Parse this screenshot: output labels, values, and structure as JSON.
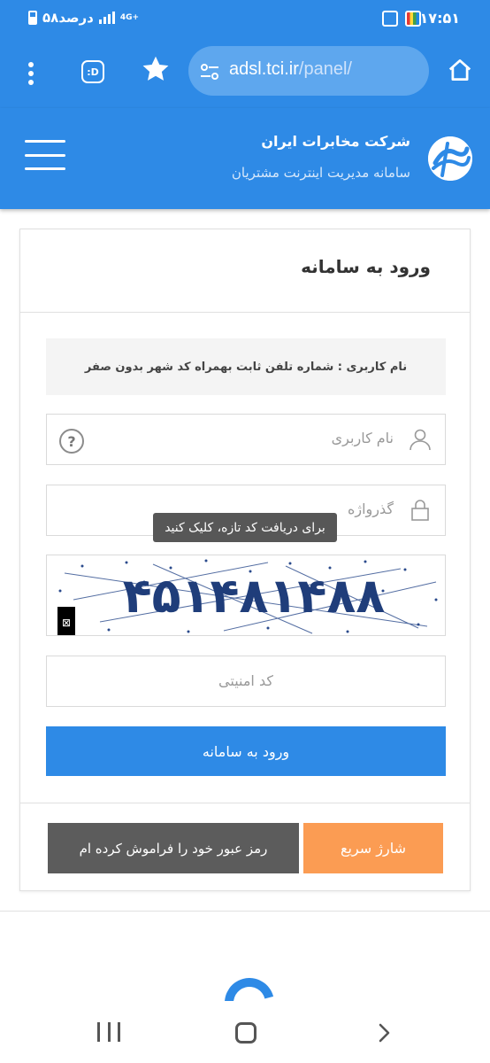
{
  "status_bar": {
    "time": "۱۷:۵۱",
    "battery": "۵۸درصد",
    "network": "4G+"
  },
  "browser": {
    "url_host": "adsl.tci.ir",
    "url_path": "/panel/",
    "ext_label": ":D",
    "icons": [
      "menu-dots-icon",
      "extension-icon",
      "star-icon",
      "site-settings-icon",
      "home-icon"
    ]
  },
  "header": {
    "title": "شرکت مخابرات ایران",
    "subtitle": "سامانه مدیریت اینترنت مشتریان"
  },
  "login": {
    "title": "ورود به سامانه",
    "notice": "نام کاربری : شماره تلفن ثابت بهمراه کد شهر بدون صفر",
    "username_placeholder": "نام کاربری",
    "help_label": "?",
    "password_placeholder": "گذرواژه",
    "tooltip": "برای دریافت کد تازه، کلیک کنید",
    "captcha_text": "۴۵۱۴۸۱۴۸۸",
    "refresh_glyph": "⊠",
    "security_code_placeholder": "کد امنیتی",
    "submit_label": "ورود به سامانه",
    "quick_charge_label": "شارژ سریع",
    "forgot_label": "رمز عبور خود را فراموش کرده ام"
  },
  "colors": {
    "primary": "#2e8ae6",
    "quick_charge": "#fb9c53",
    "forgot": "#5c5c5c",
    "captcha_ink": "#1f3d7a"
  }
}
